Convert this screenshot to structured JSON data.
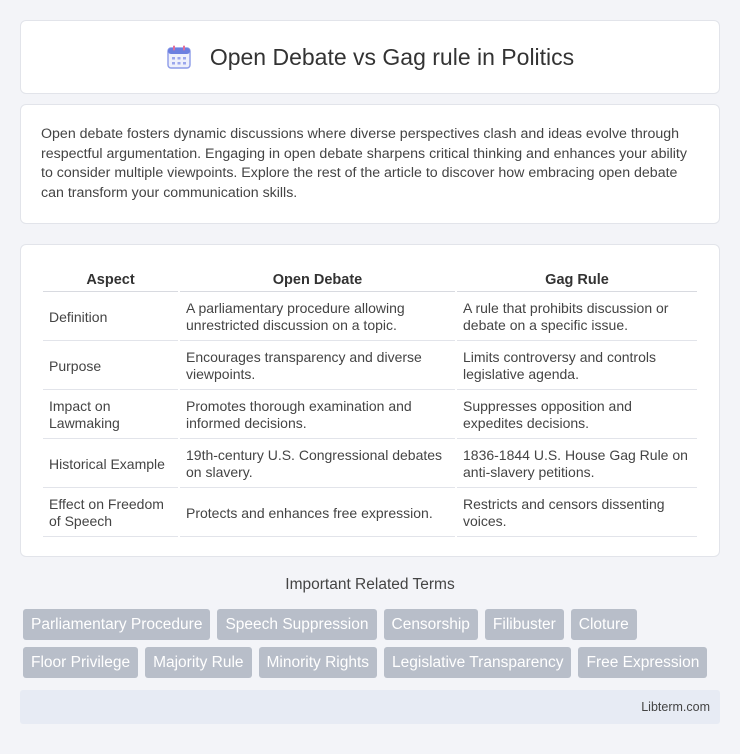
{
  "header": {
    "title": "Open Debate vs Gag rule in Politics",
    "icon": "calendar-icon"
  },
  "intro": {
    "text": "Open debate fosters dynamic discussions where diverse perspectives clash and ideas evolve through respectful argumentation. Engaging in open debate sharpens critical thinking and enhances your ability to consider multiple viewpoints. Explore the rest of the article to discover how embracing open debate can transform your communication skills."
  },
  "table": {
    "headers": [
      "Aspect",
      "Open Debate",
      "Gag Rule"
    ],
    "rows": [
      [
        "Definition",
        "A parliamentary procedure allowing unrestricted discussion on a topic.",
        "A rule that prohibits discussion or debate on a specific issue."
      ],
      [
        "Purpose",
        "Encourages transparency and diverse viewpoints.",
        "Limits controversy and controls legislative agenda."
      ],
      [
        "Impact on Lawmaking",
        "Promotes thorough examination and informed decisions.",
        "Suppresses opposition and expedites decisions."
      ],
      [
        "Historical Example",
        "19th-century U.S. Congressional debates on slavery.",
        "1836-1844 U.S. House Gag Rule on anti-slavery petitions."
      ],
      [
        "Effect on Freedom of Speech",
        "Protects and enhances free expression.",
        "Restricts and censors dissenting voices."
      ]
    ]
  },
  "related": {
    "title": "Important Related Terms",
    "row1": [
      "Parliamentary Procedure",
      "Speech Suppression",
      "Censorship",
      "Filibuster",
      "Cloture"
    ],
    "row2": [
      "Floor Privilege",
      "Majority Rule",
      "Minority Rights",
      "Legislative Transparency",
      "Free Expression"
    ]
  },
  "footer": {
    "text": "Libterm.com"
  },
  "colors": {
    "tag_bg": "#b8bec9",
    "page_bg": "#f3f4f8",
    "icon_accent": "#6b7fe0"
  }
}
